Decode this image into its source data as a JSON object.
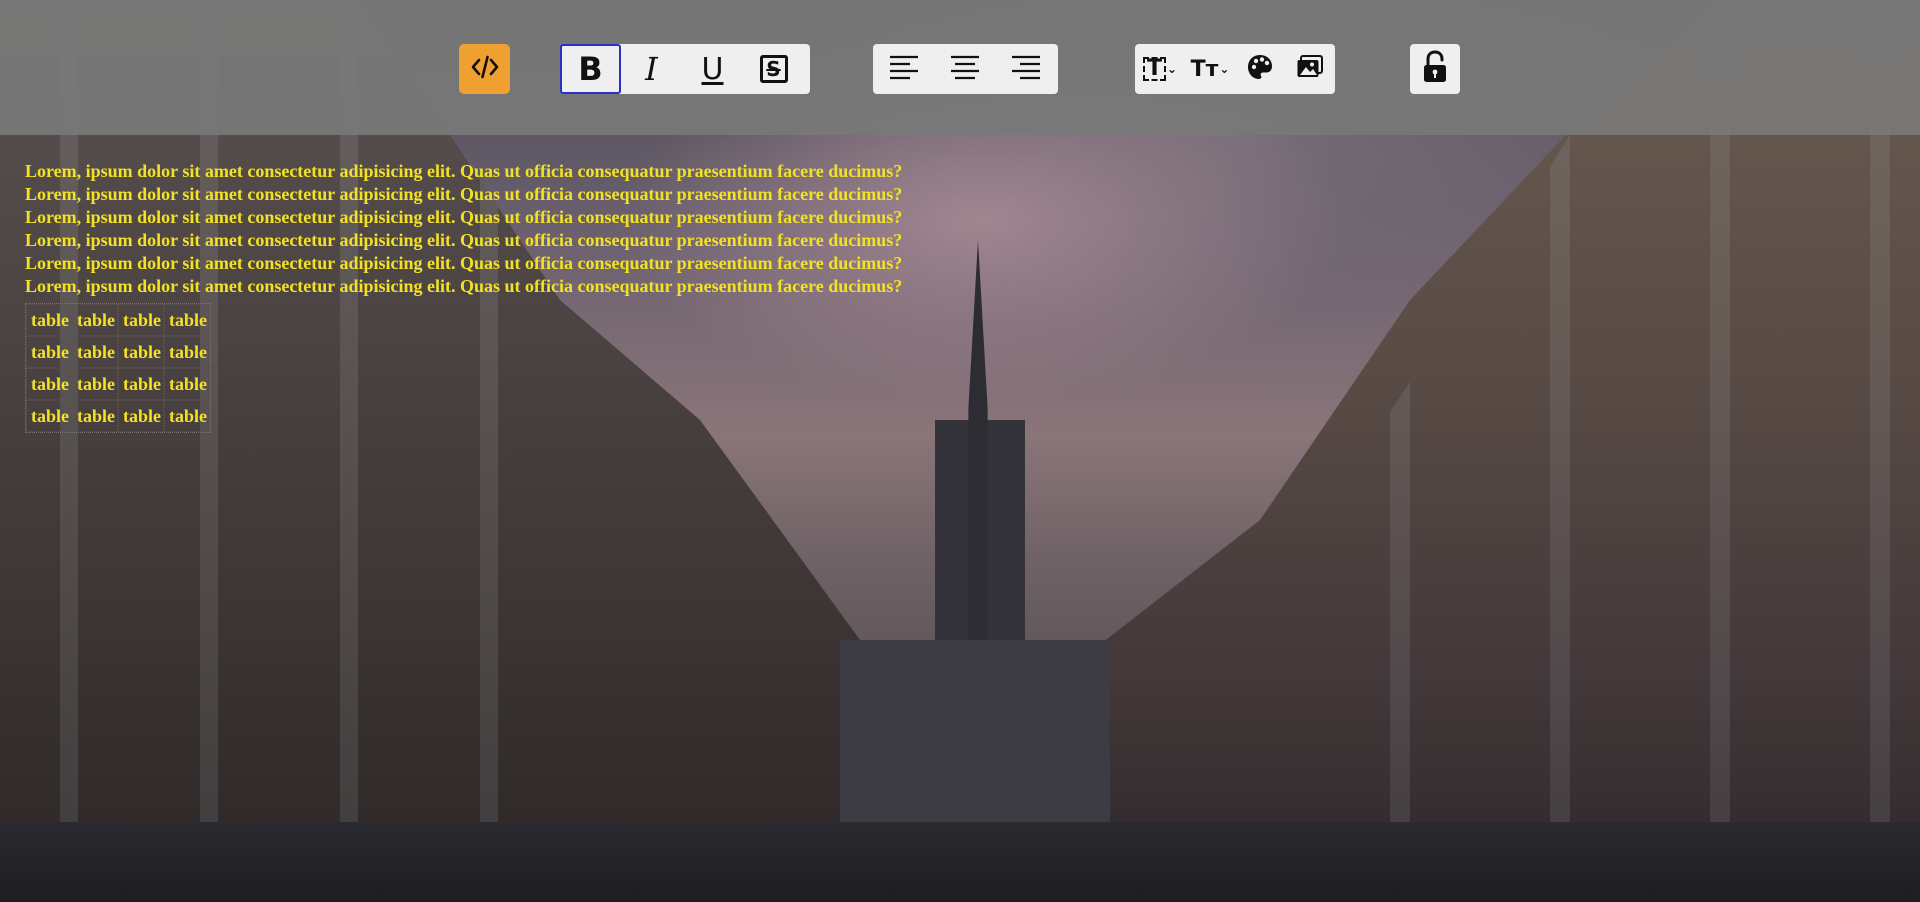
{
  "toolbar": {
    "code_button": {
      "icon": "code-icon",
      "color": "#f0a030"
    },
    "format_group": [
      {
        "name": "bold",
        "glyph": "B",
        "active": true
      },
      {
        "name": "italic",
        "glyph": "I",
        "active": false
      },
      {
        "name": "underline",
        "glyph": "U",
        "active": false
      },
      {
        "name": "strikethrough",
        "glyph": "S",
        "active": false
      }
    ],
    "align_group": [
      "align-left-icon",
      "align-center-icon",
      "align-right-icon"
    ],
    "style_group": [
      {
        "icon": "font-family-icon",
        "glyph": "T"
      },
      {
        "icon": "font-size-icon",
        "glyph": "Tт"
      },
      {
        "icon": "palette-icon"
      },
      {
        "icon": "image-icon"
      }
    ],
    "lock_button": {
      "icon": "unlock-icon"
    }
  },
  "editor": {
    "text_color": "#f2e226",
    "paragraphs": [
      "Lorem, ipsum dolor sit amet consectetur adipisicing elit. Quas ut officia consequatur praesentium facere ducimus?",
      "Lorem, ipsum dolor sit amet consectetur adipisicing elit. Quas ut officia consequatur praesentium facere ducimus?",
      "Lorem, ipsum dolor sit amet consectetur adipisicing elit. Quas ut officia consequatur praesentium facere ducimus?",
      "Lorem, ipsum dolor sit amet consectetur adipisicing elit. Quas ut officia consequatur praesentium facere ducimus?",
      "Lorem, ipsum dolor sit amet consectetur adipisicing elit. Quas ut officia consequatur praesentium facere ducimus?",
      "Lorem, ipsum dolor sit amet consectetur adipisicing elit. Quas ut officia consequatur praesentium facere ducimus?"
    ],
    "table": [
      [
        "table",
        "table",
        "table",
        "table"
      ],
      [
        "table",
        "table",
        "table",
        "table"
      ],
      [
        "table",
        "table",
        "table",
        "table"
      ],
      [
        "table",
        "table",
        "table",
        "table"
      ]
    ]
  }
}
